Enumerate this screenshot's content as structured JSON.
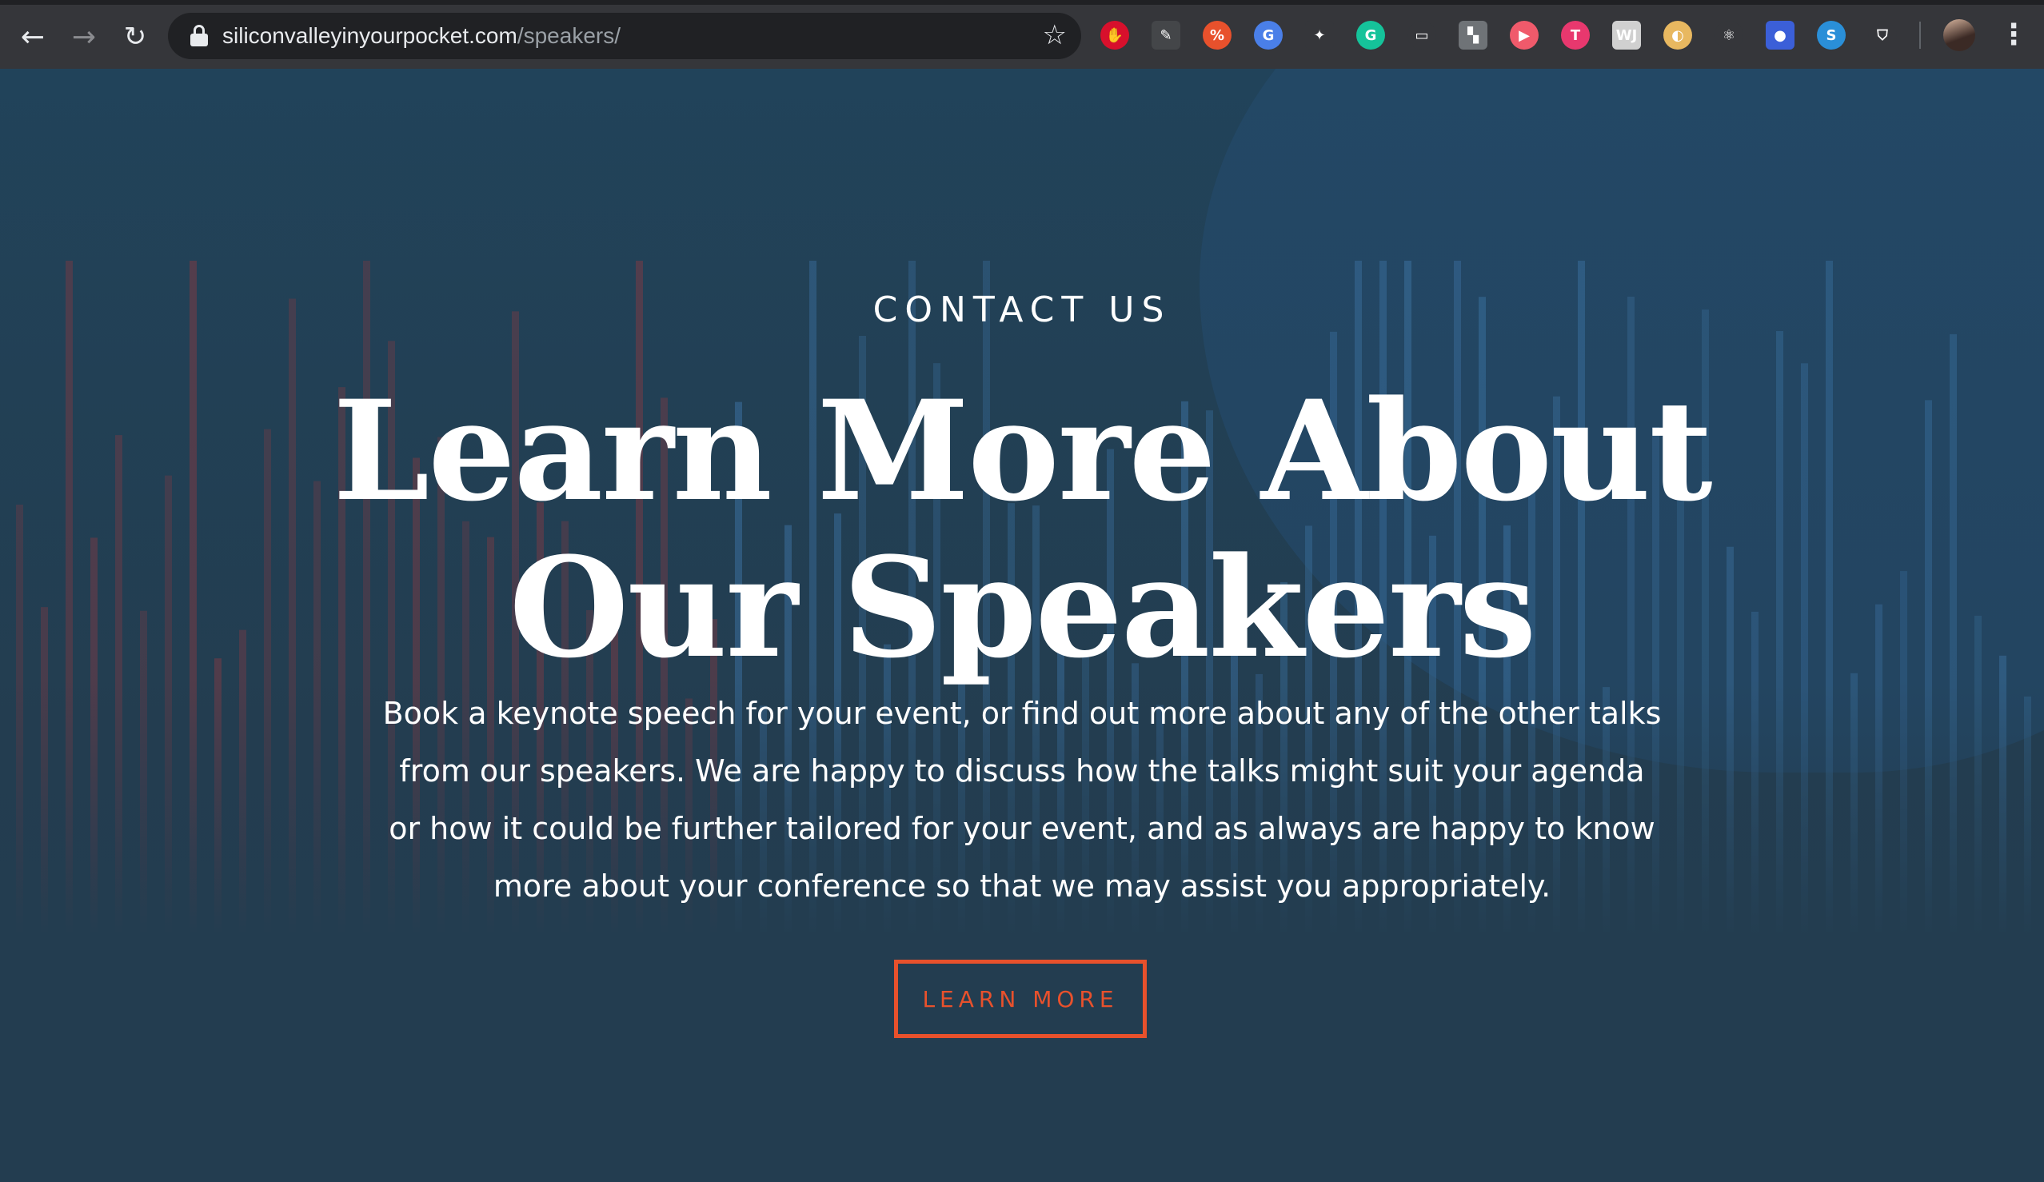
{
  "browser": {
    "url_host": "siliconvalleyinyourpocket.com",
    "url_path": "/speakers/",
    "extensions": [
      {
        "name": "ublock-icon",
        "color": "#d8102c",
        "glyph": "✋"
      },
      {
        "name": "pen-icon",
        "color": "#444649",
        "glyph": "✎"
      },
      {
        "name": "translate-icon",
        "color": "#e8512c",
        "glyph": "%"
      },
      {
        "name": "google-translate-icon",
        "color": "#4a7fe8",
        "glyph": "G"
      },
      {
        "name": "bird-icon",
        "color": "#35363a",
        "glyph": "✦"
      },
      {
        "name": "grammarly-icon",
        "color": "#15c39a",
        "glyph": "G"
      },
      {
        "name": "cast-icon",
        "color": "#35363a",
        "glyph": "▭"
      },
      {
        "name": "puzzle-icon",
        "color": "#6f7377",
        "glyph": "▚"
      },
      {
        "name": "video-icon",
        "color": "#f05a6b",
        "glyph": "▶"
      },
      {
        "name": "t-icon",
        "color": "#e8386e",
        "glyph": "T"
      },
      {
        "name": "wj-icon",
        "color": "#d0d0d0",
        "glyph": "WJ"
      },
      {
        "name": "color-picker-icon",
        "color": "#e8b860",
        "glyph": "◐"
      },
      {
        "name": "react-icon",
        "color": "#35363a",
        "glyph": "⚛"
      },
      {
        "name": "firefox-icon",
        "color": "#3b5fd8",
        "glyph": "●"
      },
      {
        "name": "s-icon",
        "color": "#2a8fd8",
        "glyph": "S"
      },
      {
        "name": "shield-icon",
        "color": "#35363a",
        "glyph": "⛉"
      }
    ]
  },
  "hero": {
    "eyebrow": "CONTACT US",
    "title_line1": "Learn More About",
    "title_line2": "Our Speakers",
    "lede": "Book a keynote speech for your event, or find out more about any of the other talks from our speakers. We are happy to discuss how the talks might suit your agenda or how it could be further tailored for your event, and as always are happy to know more about your conference so that we may assist you appropriately.",
    "cta_label": "LEARN MORE"
  },
  "colors": {
    "background": "#233d50",
    "accent": "#e8512c",
    "text": "#ffffff"
  }
}
